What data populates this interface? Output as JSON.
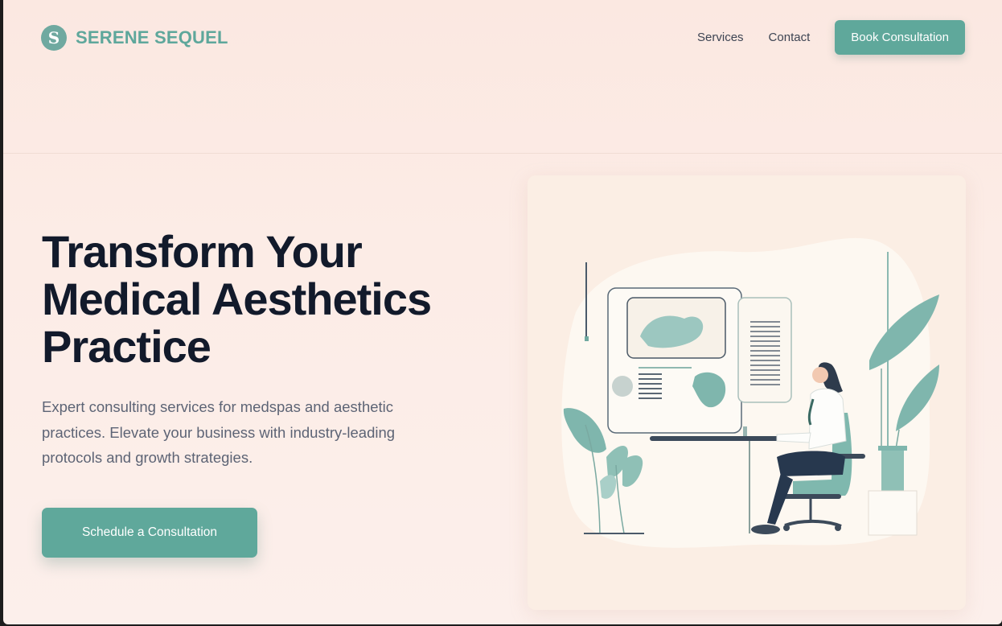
{
  "brand": {
    "logo_letter": "S",
    "name": "SERENE SEQUEL"
  },
  "nav": {
    "links": [
      "Services",
      "Contact"
    ],
    "cta_label": "Book Consultation"
  },
  "hero": {
    "title_lines": [
      "Transform Your",
      "Medical Aesthetics",
      "Practice"
    ],
    "subtitle_lines": [
      "Expert consulting services for medspas and aesthetic",
      "practices. Elevate your business with industry-leading",
      "protocols and growth strategies."
    ],
    "cta_label": "Schedule a Consultation"
  },
  "illustration": {
    "description_icon": "doctor-at-desk-illustration"
  },
  "colors": {
    "accent": "#5fa89b",
    "heading": "#121a2b",
    "body_text": "#5d6475",
    "background": "#fbe8e1"
  }
}
